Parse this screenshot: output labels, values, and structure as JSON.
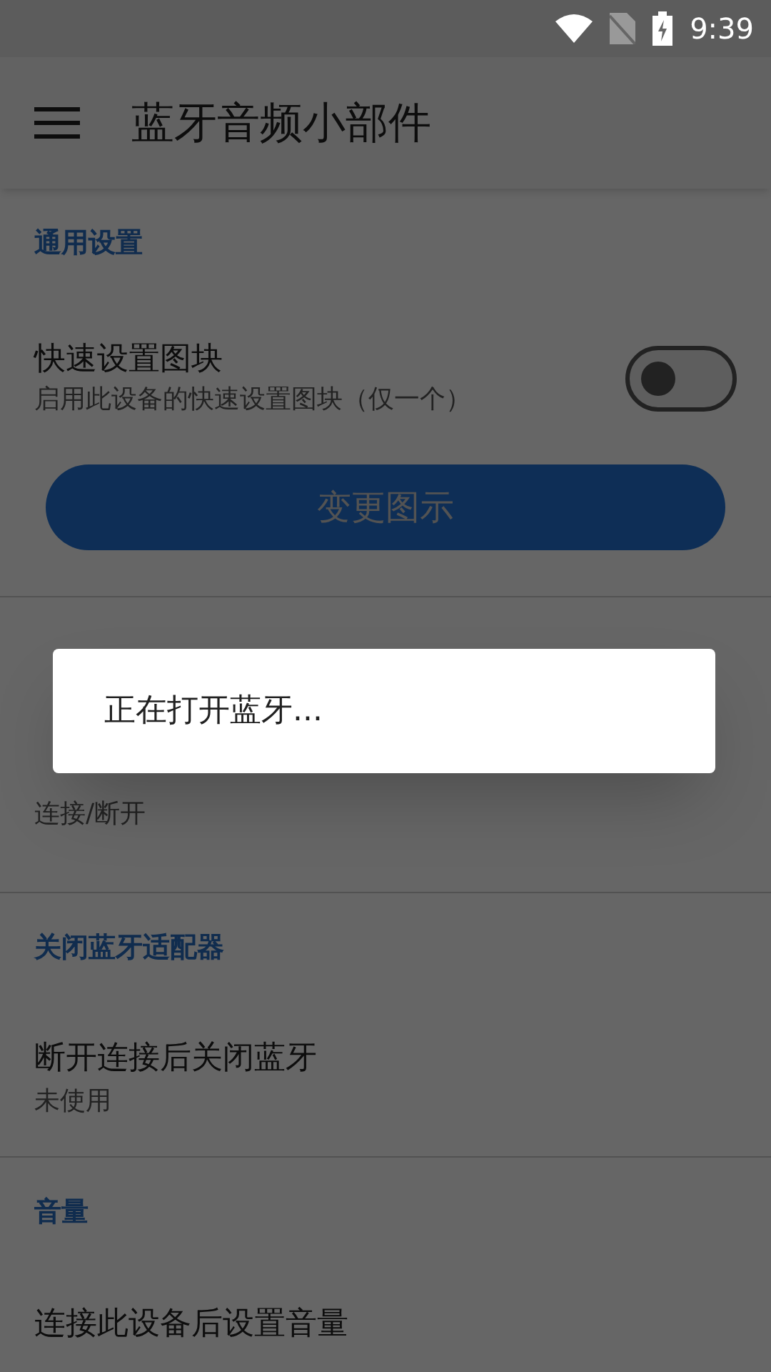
{
  "status_bar": {
    "time": "9:39"
  },
  "app_bar": {
    "title": "蓝牙音频小部件"
  },
  "sections": [
    {
      "header": "通用设置",
      "items": [
        {
          "kind": "switch",
          "title": "快速设置图块",
          "subtitle": "启用此设备的快速设置图块（仅一个）",
          "on": false
        },
        {
          "kind": "button",
          "label": "变更图示"
        }
      ]
    },
    {
      "items": [
        {
          "kind": "text",
          "subtitle": "连接/断开"
        }
      ]
    },
    {
      "header": "关闭蓝牙适配器",
      "items": [
        {
          "kind": "text",
          "title": "断开连接后关闭蓝牙",
          "subtitle": "未使用"
        }
      ]
    },
    {
      "header": "音量",
      "items": [
        {
          "kind": "text",
          "title": "连接此设备后设置音量"
        }
      ]
    }
  ],
  "dialog": {
    "message": "正在打开蓝牙..."
  }
}
